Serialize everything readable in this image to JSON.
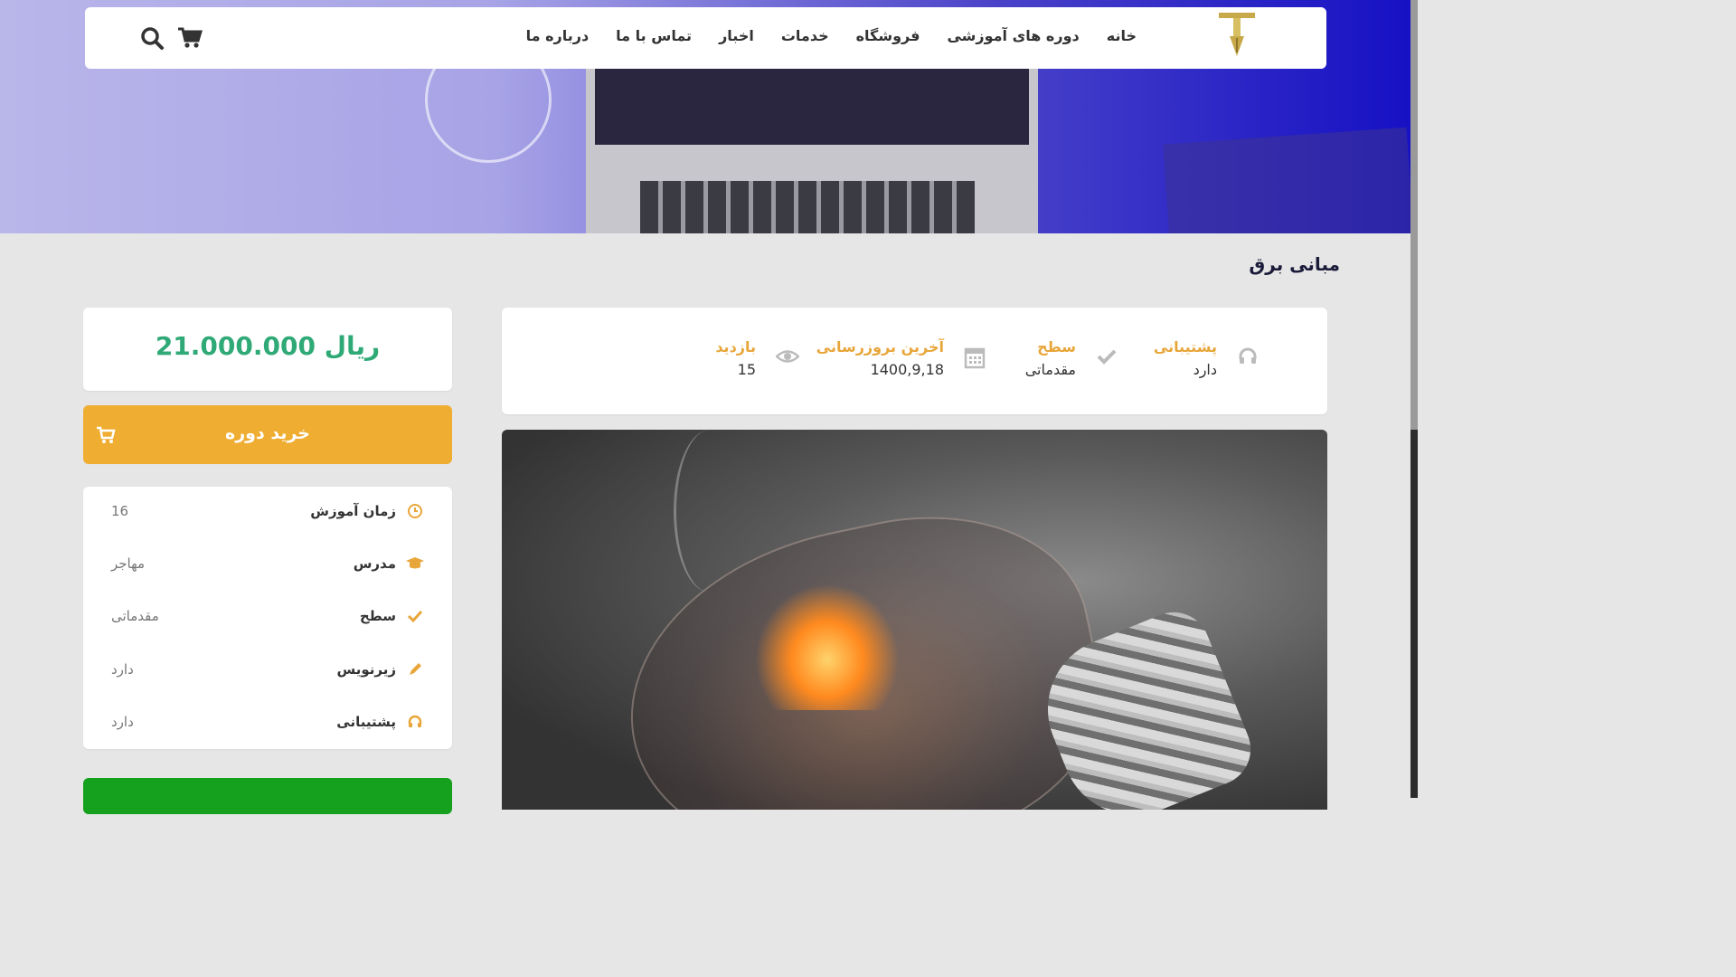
{
  "nav": {
    "links": [
      "خانه",
      "دوره های آموزشی",
      "فروشگاه",
      "خدمات",
      "اخبار",
      "تماس با ما",
      "درباره ما"
    ],
    "logo_icon": "pen-nib-logo",
    "cart_icon": "shopping-cart-icon",
    "search_icon": "search-icon"
  },
  "course": {
    "title": "مبانی برق"
  },
  "stats": [
    {
      "label": "پشتیبانی",
      "value": "دارد",
      "icon": "headphones-icon"
    },
    {
      "label": "سطح",
      "value": "مقدماتی",
      "icon": "check-icon"
    },
    {
      "label": "آخرین بروزرسانی",
      "value": "1400,9,18",
      "icon": "calendar-icon"
    },
    {
      "label": "بازدید",
      "value": "15",
      "icon": "eye-icon"
    }
  ],
  "price": {
    "amount": "21.000.000 ریال"
  },
  "buy": {
    "label": "خرید دوره"
  },
  "info": [
    {
      "label": "زمان آموزش",
      "value": "16",
      "icon": "clock-icon"
    },
    {
      "label": "مدرس",
      "value": "مهاجر",
      "icon": "graduation-cap-icon"
    },
    {
      "label": "سطح",
      "value": "مقدماتی",
      "icon": "check-icon"
    },
    {
      "label": "زیرنویس",
      "value": "دارد",
      "icon": "pencil-icon"
    },
    {
      "label": "پشتیبانی",
      "value": "دارد",
      "icon": "headphones-icon"
    }
  ],
  "colors": {
    "accent": "#efad32",
    "price": "#2fa976",
    "stat_label": "#e8a63a",
    "green_button": "#15a11d"
  }
}
